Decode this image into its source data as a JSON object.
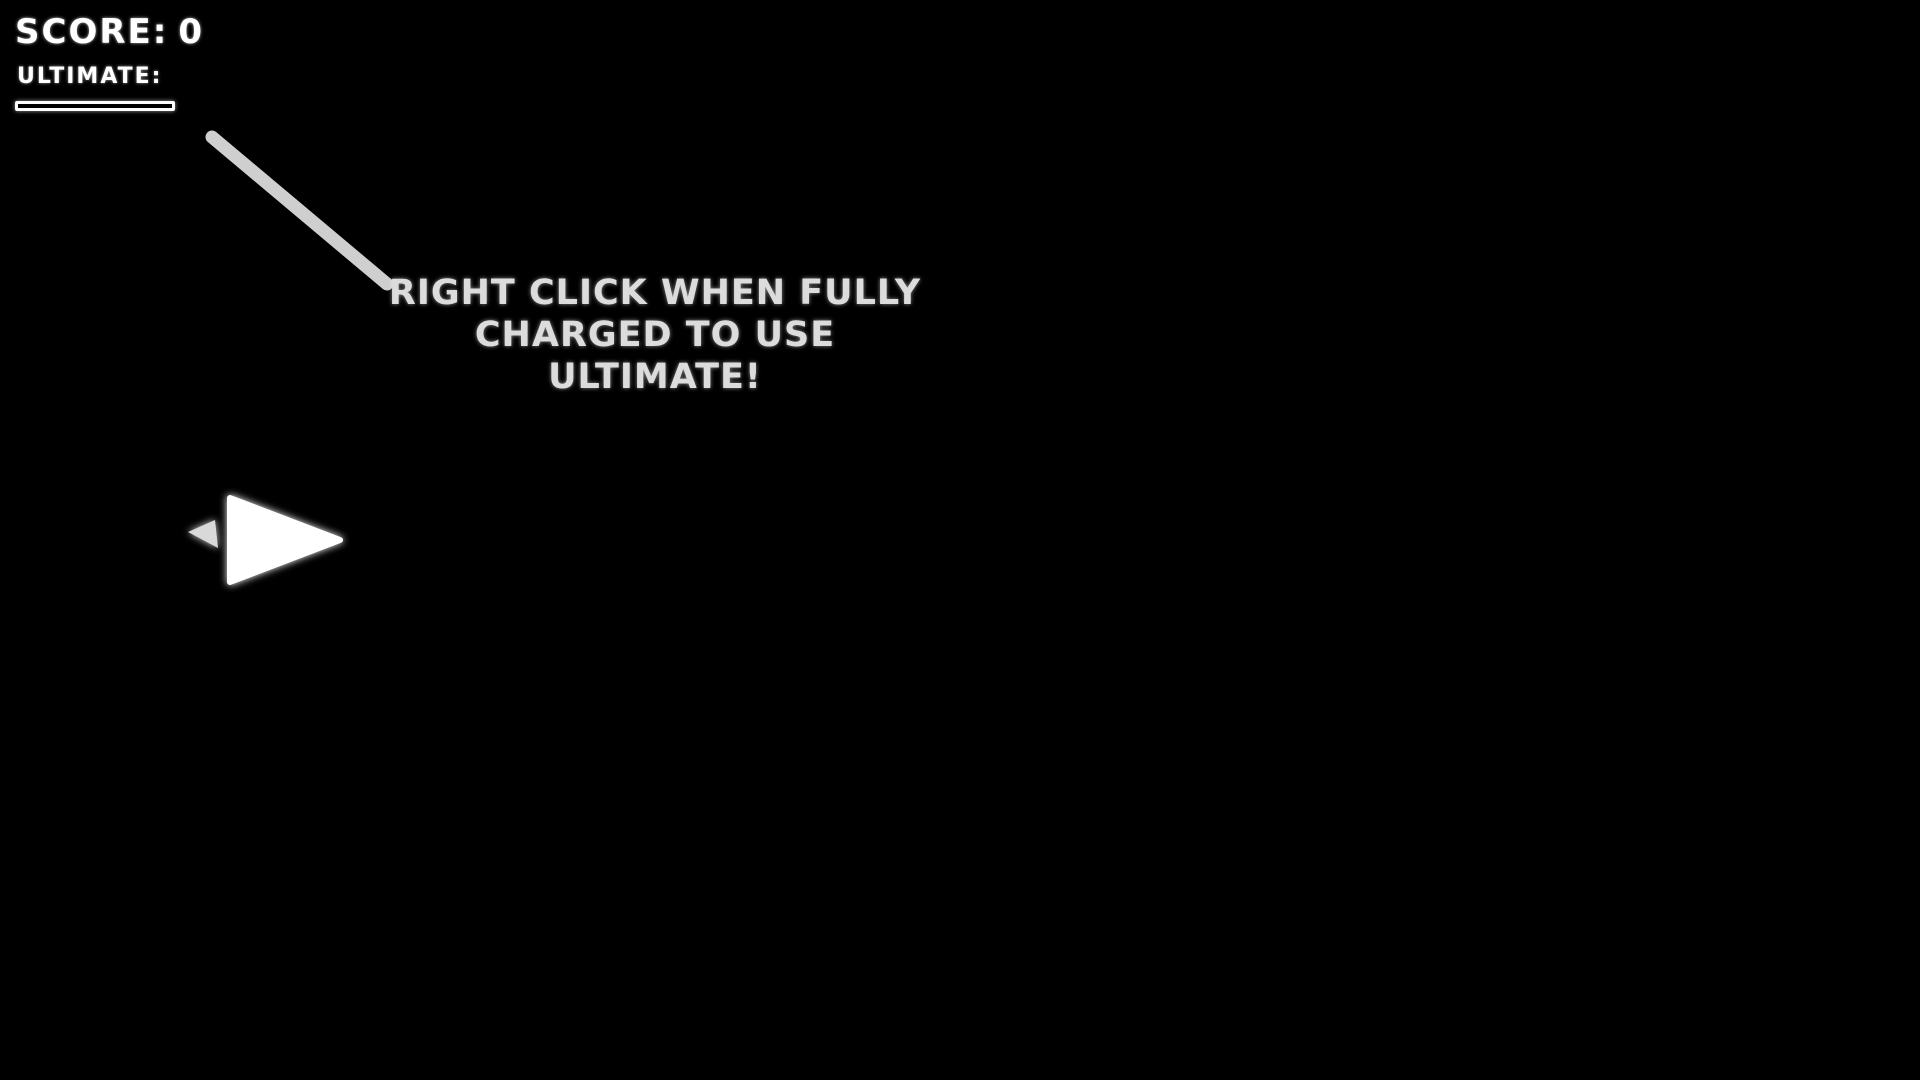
{
  "hud": {
    "score_label": "SCORE:",
    "score_value": "0",
    "ultimate_label": "ULTIMATE:",
    "ultimate_charge": 0
  },
  "tutorial": {
    "line1": "RIGHT CLICK WHEN FULLY",
    "line2": "CHARGED TO USE ULTIMATE!"
  },
  "colors": {
    "background": "#000000",
    "foreground": "#ffffff",
    "tutorial_text": "#dcdcdc",
    "pointer_line": "#cfcfcf"
  },
  "icons": {
    "player": "triangle-ship-icon"
  }
}
